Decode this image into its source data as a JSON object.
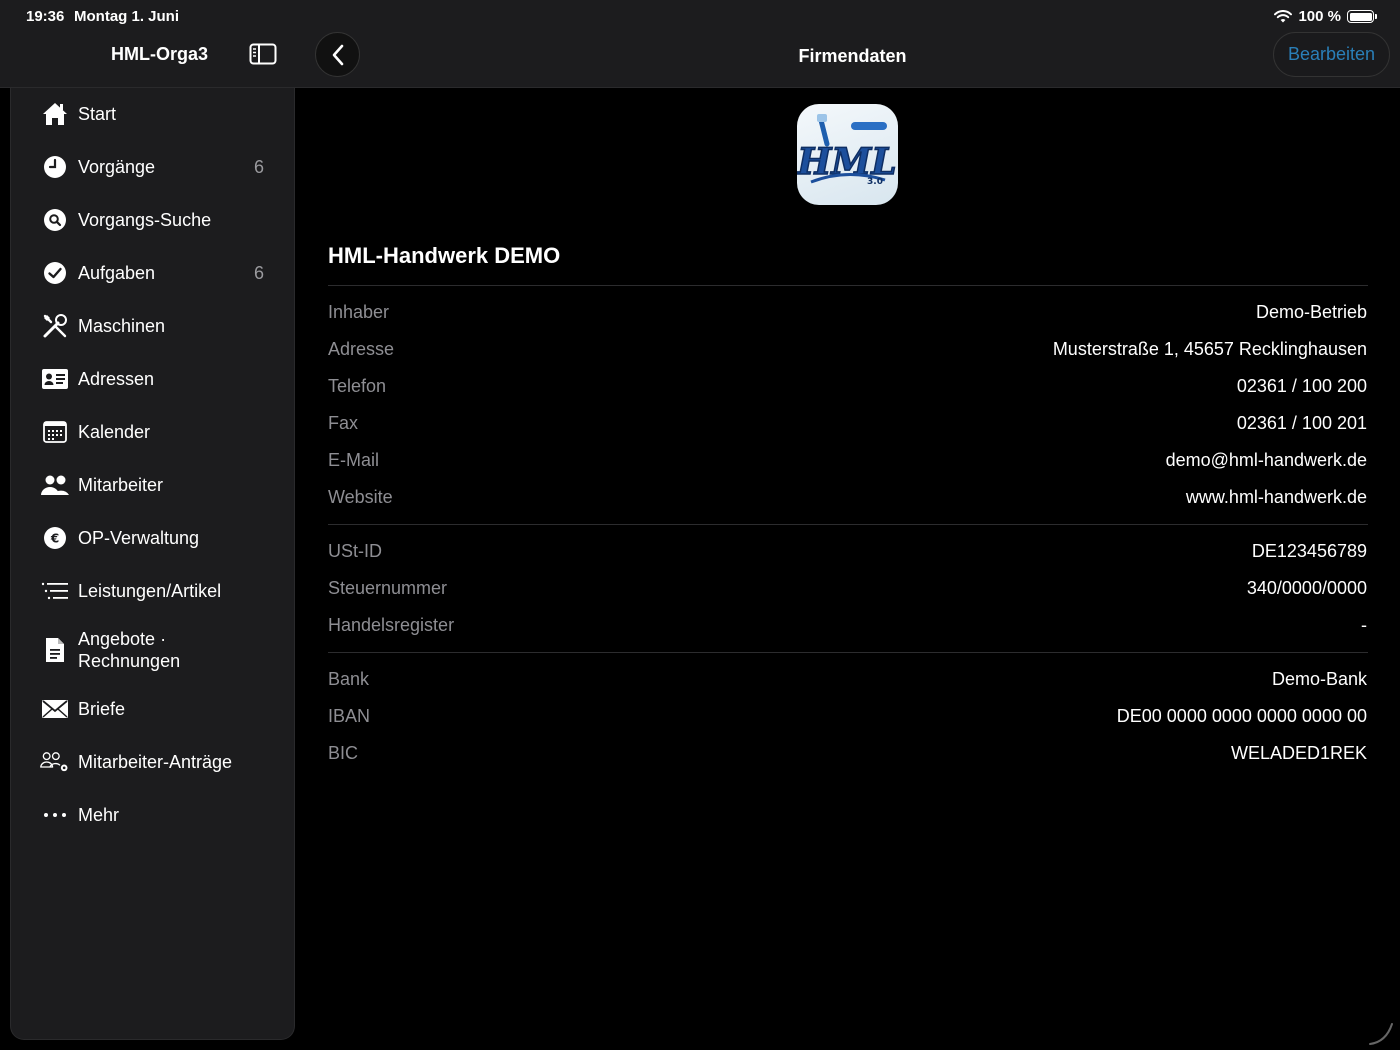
{
  "status": {
    "time": "19:36",
    "date": "Montag 1. Juni",
    "battery": "100 %"
  },
  "nav": {
    "app_title": "HML-Orga3",
    "page_title": "Firmendaten",
    "edit_label": "Bearbeiten"
  },
  "sidebar": {
    "items": [
      {
        "label": "Start",
        "icon": "house-icon"
      },
      {
        "label": "Vorgänge",
        "count": "6",
        "icon": "clock-icon"
      },
      {
        "label": "Vorgangs-Suche",
        "icon": "search-circle-icon"
      },
      {
        "label": "Aufgaben",
        "count": "6",
        "icon": "checkmark-circle-icon"
      },
      {
        "label": "Maschinen",
        "icon": "tools-icon"
      },
      {
        "label": "Adressen",
        "icon": "contact-card-icon"
      },
      {
        "label": "Kalender",
        "icon": "calendar-icon"
      },
      {
        "label": "Mitarbeiter",
        "icon": "people-icon"
      },
      {
        "label": "OP-Verwaltung",
        "icon": "euro-circle-icon"
      },
      {
        "label": "Leistungen/Artikel",
        "icon": "list-icon"
      },
      {
        "label": "Angebote ·\nRechnungen",
        "icon": "document-icon"
      },
      {
        "label": "Briefe",
        "icon": "envelope-icon"
      },
      {
        "label": "Mitarbeiter-Anträge",
        "icon": "people-gear-icon"
      },
      {
        "label": "Mehr",
        "icon": "ellipsis-icon"
      }
    ]
  },
  "company": {
    "logo_text": "HML",
    "logo_version": "3.0",
    "name": "HML-Handwerk DEMO",
    "contact": [
      {
        "key": "Inhaber",
        "value": "Demo-Betrieb"
      },
      {
        "key": "Adresse",
        "value": "Musterstraße 1, 45657 Recklinghausen"
      },
      {
        "key": "Telefon",
        "value": "02361 / 100 200"
      },
      {
        "key": "Fax",
        "value": "02361 / 100 201"
      },
      {
        "key": "E-Mail",
        "value": "demo@hml-handwerk.de"
      },
      {
        "key": "Website",
        "value": "www.hml-handwerk.de"
      }
    ],
    "tax": [
      {
        "key": "USt-ID",
        "value": "DE123456789"
      },
      {
        "key": "Steuernummer",
        "value": "340/0000/0000"
      },
      {
        "key": "Handelsregister",
        "value": "-"
      }
    ],
    "bank": [
      {
        "key": "Bank",
        "value": "Demo-Bank"
      },
      {
        "key": "IBAN",
        "value": "DE00 0000 0000 0000 0000 00"
      },
      {
        "key": "BIC",
        "value": "WELADED1REK"
      }
    ]
  },
  "colors": {
    "accent": "#2a7fb8",
    "background": "#000000",
    "panel": "#1c1c1e",
    "secondary_text": "#8e8e93"
  }
}
